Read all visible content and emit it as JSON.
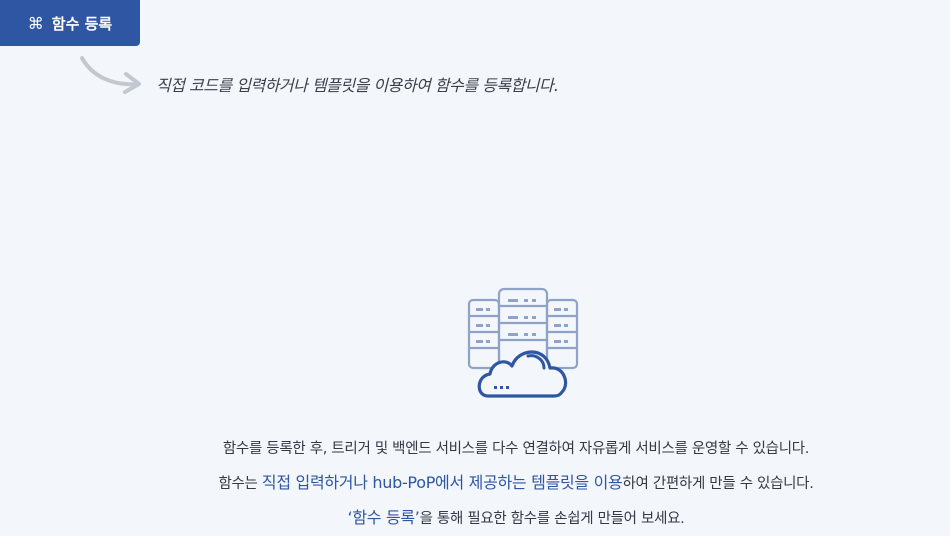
{
  "header": {
    "icon": "command-icon",
    "register_label": "함수 등록"
  },
  "hint": {
    "text": "직접 코드를 입력하거나 템플릿을 이용하여 함수를 등록합니다."
  },
  "illustration": {
    "icon": "server-cloud-icon",
    "colors": {
      "server": "#8fa3c8",
      "cloud": "#2f56a3"
    }
  },
  "description": {
    "line1": "함수를 등록한 후, 트리거 및 백엔드 서비스를 다수 연결하여 자유롭게 서비스를 운영할 수 있습니다.",
    "line2_pre": "함수는 ",
    "line2_highlight": "직접 입력하거나 hub-PoP에서 제공하는 템플릿을 이용",
    "line2_post": "하여 간편하게 만들 수 있습니다.",
    "line3_highlight": "‘함수 등록’",
    "line3_post": "을 통해 필요한 함수를 손쉽게 만들어 보세요."
  },
  "colors": {
    "accent": "#2f56a3",
    "background": "#f3f6fa",
    "text": "#333a45"
  }
}
